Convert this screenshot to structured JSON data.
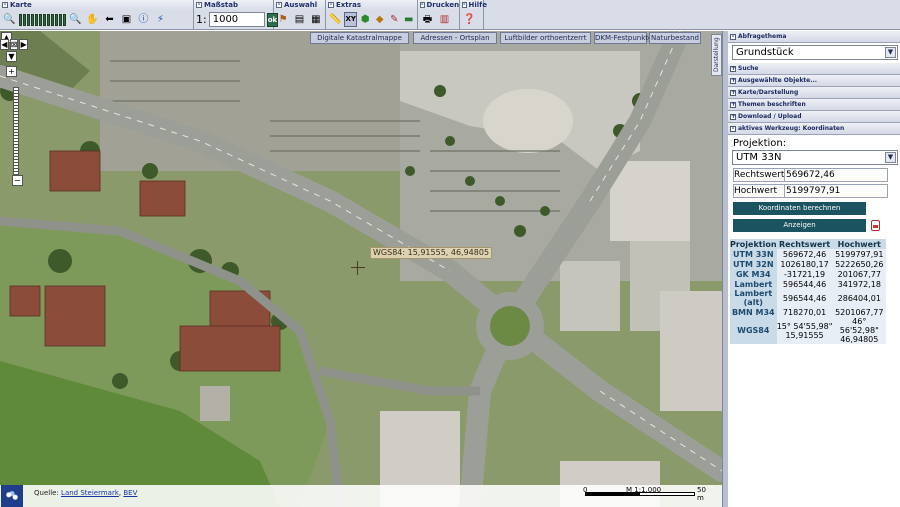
{
  "toolbar": {
    "karte_title": "Karte",
    "massstab_title": "Maßstab",
    "auswahl_title": "Auswahl",
    "extras_title": "Extras",
    "drucken_title": "Drucken",
    "hilfe_title": "Hilfe",
    "scale_prefix": "1:",
    "scale_value": "1000",
    "scale_ok": "ok"
  },
  "map": {
    "tabs": [
      "Digitale Katastralmappe",
      "Adressen - Ortsplan",
      "Luftbilder orthoentzerrt",
      "DKM-Festpunkte",
      "Naturbestand"
    ],
    "coordinate_tooltip": "WGS84: 15,91555, 46,94805",
    "source_label": "Quelle:",
    "source_links": [
      "Land Steiermark",
      "BEV"
    ],
    "scale_left": "0",
    "scale_mid": "M 1:1.000",
    "scale_right": "50 m"
  },
  "panel": {
    "vertical_tab": "Darstellung",
    "abfragethema_title": "Abfragethema",
    "abfragethema_value": "Grundstück",
    "sections": [
      "Suche",
      "Ausgewählte Objekte...",
      "Karte/Darstellung",
      "Themen beschriften",
      "Download / Upload"
    ],
    "tool_title": "aktives Werkzeug: Koordinaten",
    "projektion_label": "Projektion:",
    "projektion_value": "UTM 33N",
    "rechtswert_label": "Rechtswert",
    "rechtswert_value": "569672,46",
    "hochwert_label": "Hochwert",
    "hochwert_value": "5199797,91",
    "calc_button": "Koordinaten berechnen",
    "show_button": "Anzeigen",
    "table": {
      "headers": [
        "Projektion",
        "Rechtswert",
        "Hochwert"
      ],
      "rows": [
        {
          "name": "UTM 33N",
          "r": "569672,46",
          "h": "5199797,91"
        },
        {
          "name": "UTM 32N",
          "r": "1026180,17",
          "h": "5222650,26"
        },
        {
          "name": "GK M34",
          "r": "-31721,19",
          "h": "201067,77"
        },
        {
          "name": "Lambert",
          "r": "596544,46",
          "h": "341972,18"
        },
        {
          "name": "Lambert (alt)",
          "r": "596544,46",
          "h": "286404,01"
        },
        {
          "name": "BMN M34",
          "r": "718270,01",
          "h": "5201067,77"
        },
        {
          "name": "WGS84",
          "r": "15° 54'55,98\" 15,91555",
          "h": "46° 56'52,98\" 46,94805"
        }
      ]
    }
  }
}
